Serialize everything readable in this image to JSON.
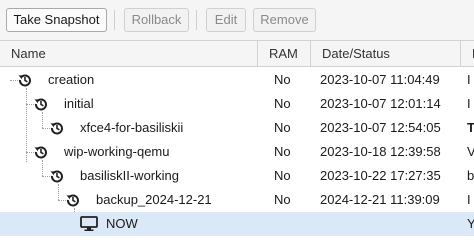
{
  "toolbar": {
    "take_snapshot": "Take Snapshot",
    "rollback": "Rollback",
    "edit": "Edit",
    "remove": "Remove"
  },
  "columns": {
    "name": "Name",
    "ram": "RAM",
    "date": "Date/Status",
    "desc": "D"
  },
  "rows": [
    {
      "name": "creation",
      "ram": "No",
      "date": "2023-10-07 11:04:49",
      "desc": "I",
      "icon": "snapshot-history-icon"
    },
    {
      "name": "initial",
      "ram": "No",
      "date": "2023-10-07 12:01:14",
      "desc": "I",
      "icon": "snapshot-history-icon"
    },
    {
      "name": "xfce4-for-basiliskii",
      "ram": "No",
      "date": "2023-10-07 12:54:05",
      "desc": "T",
      "icon": "snapshot-history-icon"
    },
    {
      "name": "wip-working-qemu",
      "ram": "No",
      "date": "2023-10-18 12:39:58",
      "desc": "V",
      "icon": "snapshot-history-icon"
    },
    {
      "name": "basiliskII-working",
      "ram": "No",
      "date": "2023-10-22 17:27:35",
      "desc": "b",
      "icon": "snapshot-history-icon"
    },
    {
      "name": "backup_2024-12-21",
      "ram": "No",
      "date": "2024-12-21 11:39:09",
      "desc": "I",
      "icon": "snapshot-history-icon"
    },
    {
      "name": "NOW",
      "ram": "",
      "date": "",
      "desc": "Y",
      "icon": "monitor-icon"
    }
  ],
  "colors": {
    "selected_row": "#dbe8f7"
  }
}
